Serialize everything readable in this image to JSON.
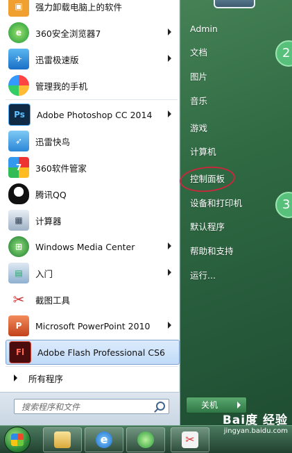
{
  "left_menu": {
    "items": [
      {
        "label": "强力卸载电脑上的软件",
        "icon": "uninstall-box-icon",
        "has_arrow": false
      },
      {
        "label": "360安全浏览器7",
        "icon": "browser-360-icon",
        "has_arrow": true
      },
      {
        "label": "迅雷极速版",
        "icon": "thunder-icon",
        "has_arrow": true
      },
      {
        "label": "管理我的手机",
        "icon": "phone-manager-icon",
        "has_arrow": false
      },
      {
        "label": "Adobe Photoshop CC 2014",
        "icon": "photoshop-icon",
        "has_arrow": true
      },
      {
        "label": "迅雷快鸟",
        "icon": "thunder-bird-icon",
        "has_arrow": false
      },
      {
        "label": "360软件管家",
        "icon": "software-manager-icon",
        "has_arrow": false
      },
      {
        "label": "腾讯QQ",
        "icon": "qq-penguin-icon",
        "has_arrow": false
      },
      {
        "label": "计算器",
        "icon": "calculator-icon",
        "has_arrow": false
      },
      {
        "label": "Windows Media Center",
        "icon": "media-center-icon",
        "has_arrow": true
      },
      {
        "label": "入门",
        "icon": "getting-started-icon",
        "has_arrow": true
      },
      {
        "label": "截图工具",
        "icon": "snipping-tool-icon",
        "has_arrow": false
      },
      {
        "label": "Microsoft PowerPoint 2010",
        "icon": "powerpoint-icon",
        "has_arrow": true
      },
      {
        "label": "Adobe Flash Professional CS6",
        "icon": "flash-icon",
        "has_arrow": false
      }
    ],
    "ps_text": "Ps",
    "fl_text": "Fl",
    "all_programs": "所有程序",
    "search_placeholder": "搜索程序和文件"
  },
  "right_menu": {
    "items": [
      "Admin",
      "文档",
      "图片",
      "音乐",
      "游戏",
      "计算机",
      "控制面板",
      "设备和打印机",
      "默认程序",
      "帮助和支持",
      "运行..."
    ],
    "shutdown_label": "关机"
  },
  "overlays": {
    "step2": "2",
    "step3": "3"
  },
  "watermark": {
    "brand": "Bai度 经验",
    "url": "jingyan.baidu.com"
  },
  "colors": {
    "highlight_circle": "#c8283b",
    "selected_item": "#c1dbf8"
  }
}
